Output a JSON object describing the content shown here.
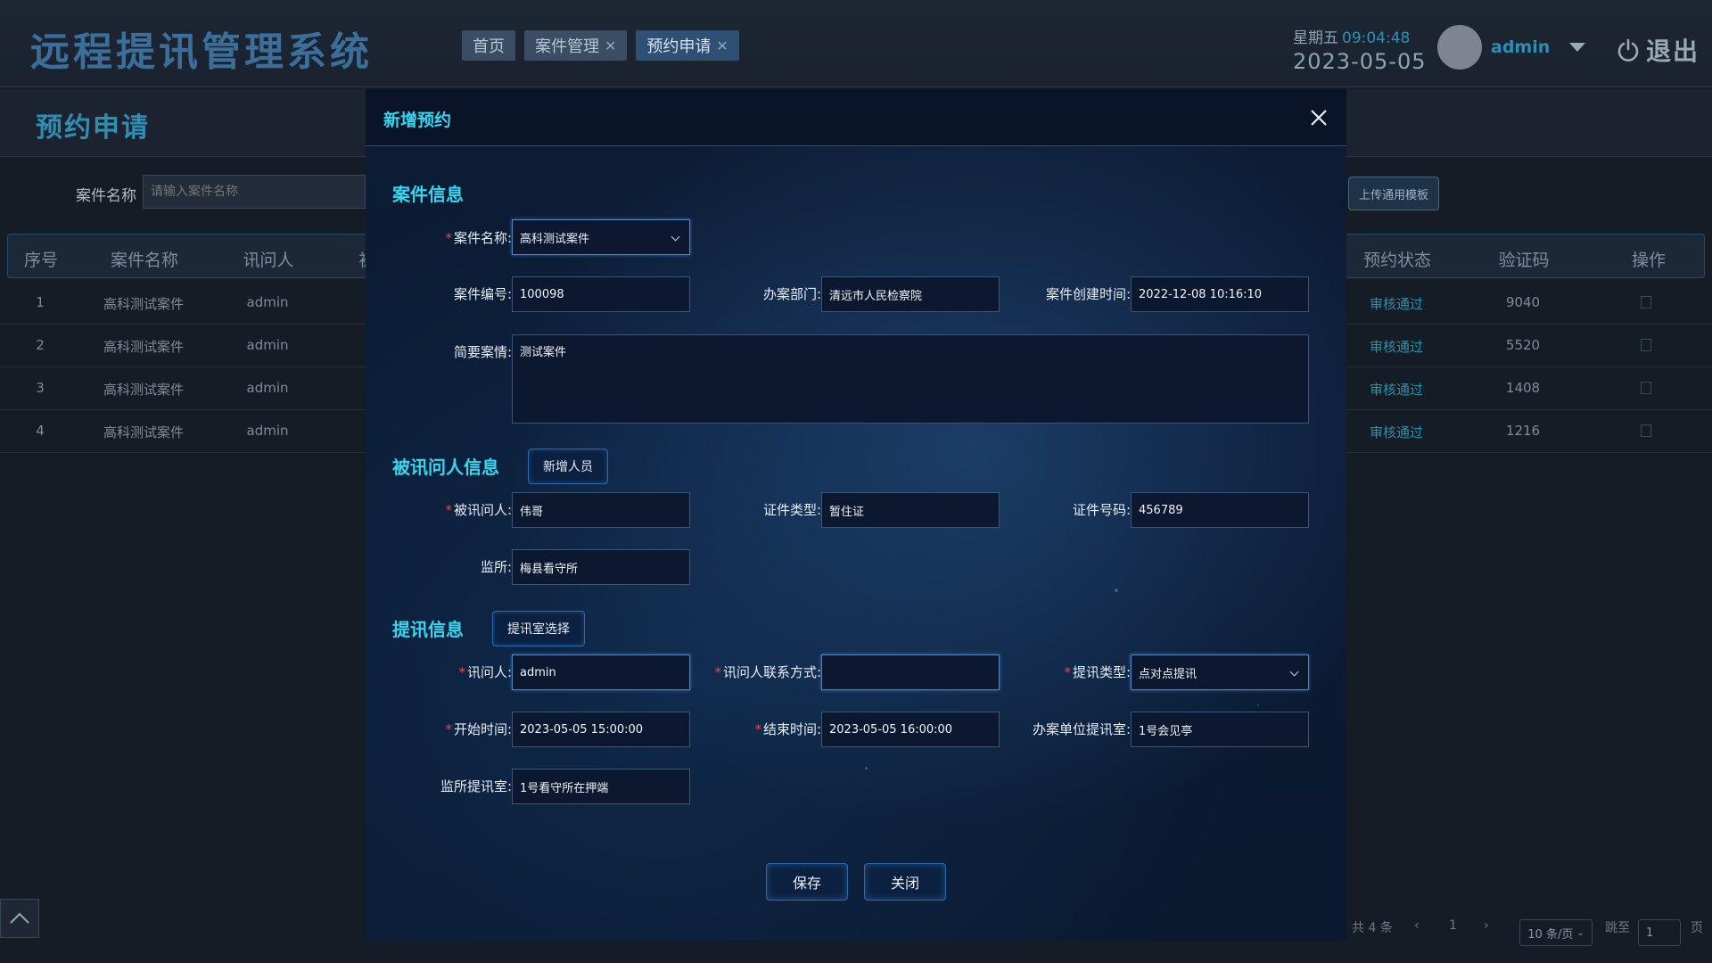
{
  "app": {
    "title": "远程提讯管理系统"
  },
  "tabs": [
    {
      "label": "首页",
      "closable": false
    },
    {
      "label": "案件管理",
      "closable": true
    },
    {
      "label": "预约申请",
      "closable": true,
      "active": true
    }
  ],
  "clock": {
    "weekday": "星期五",
    "time": "09:04:48",
    "date": "2023-05-05"
  },
  "user": {
    "name": "admin",
    "logout_label": "退出"
  },
  "page": {
    "title": "预约申请",
    "filter_label": "案件名称",
    "filter_placeholder": "请输入案件名称",
    "upload_button": "上传通用模板"
  },
  "table": {
    "headers": [
      "序号",
      "案件名称",
      "讯问人",
      "被",
      "预约状态",
      "验证码",
      "操作"
    ],
    "rows": [
      {
        "index": "1",
        "case": "高科测试案件",
        "interrogator": "admin",
        "status": "审核通过",
        "code": "9040"
      },
      {
        "index": "2",
        "case": "高科测试案件",
        "interrogator": "admin",
        "status": "审核通过",
        "code": "5520"
      },
      {
        "index": "3",
        "case": "高科测试案件",
        "interrogator": "admin",
        "status": "审核通过",
        "code": "1408"
      },
      {
        "index": "4",
        "case": "高科测试案件",
        "interrogator": "admin",
        "status": "审核通过",
        "code": "1216"
      }
    ]
  },
  "pagination": {
    "total": "共 4 条",
    "prev": "‹",
    "current": "1",
    "next": "›",
    "page_size": "10 条/页",
    "jump_label": "跳至",
    "jump_value": "1",
    "page_suffix": "页"
  },
  "modal": {
    "title": "新增预约",
    "case_section": {
      "title": "案件信息",
      "case_name_label": "案件名称:",
      "case_name_value": "高科测试案件",
      "case_no_label": "案件编号:",
      "case_no_value": "100098",
      "dept_label": "办案部门:",
      "dept_value": "清远市人民检察院",
      "created_label": "案件创建时间:",
      "created_value": "2022-12-08 10:16:10",
      "brief_label": "简要案情:",
      "brief_value": "测试案件"
    },
    "subject_section": {
      "title": "被讯问人信息",
      "add_button": "新增人员",
      "name_label": "被讯问人:",
      "name_value": "伟哥",
      "id_type_label": "证件类型:",
      "id_type_value": "暂住证",
      "id_no_label": "证件号码:",
      "id_no_value": "456789",
      "prison_label": "监所:",
      "prison_value": "梅县看守所"
    },
    "interrogation_section": {
      "title": "提讯信息",
      "room_button": "提讯室选择",
      "interrogator_label": "讯问人:",
      "interrogator_value": "admin",
      "contact_label": "讯问人联系方式:",
      "contact_value": "",
      "type_label": "提讯类型:",
      "type_value": "点对点提讯",
      "start_label": "开始时间:",
      "start_value": "2023-05-05 15:00:00",
      "end_label": "结束时间:",
      "end_value": "2023-05-05 16:00:00",
      "unit_room_label": "办案单位提讯室:",
      "unit_room_value": "1号会见亭",
      "prison_room_label": "监所提讯室:",
      "prison_room_value": "1号看守所在押端"
    },
    "buttons": {
      "save": "保存",
      "close": "关闭"
    }
  },
  "colors": {
    "accent": "#35d6ee",
    "brand": "#2f8fb2",
    "required": "#e04b4b"
  }
}
